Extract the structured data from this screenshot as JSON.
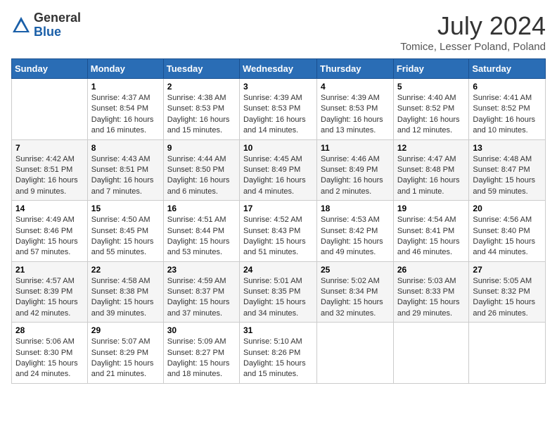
{
  "logo": {
    "general": "General",
    "blue": "Blue"
  },
  "header": {
    "title": "July 2024",
    "location": "Tomice, Lesser Poland, Poland"
  },
  "days_of_week": [
    "Sunday",
    "Monday",
    "Tuesday",
    "Wednesday",
    "Thursday",
    "Friday",
    "Saturday"
  ],
  "weeks": [
    [
      {
        "num": "",
        "info": ""
      },
      {
        "num": "1",
        "info": "Sunrise: 4:37 AM\nSunset: 8:54 PM\nDaylight: 16 hours\nand 16 minutes."
      },
      {
        "num": "2",
        "info": "Sunrise: 4:38 AM\nSunset: 8:53 PM\nDaylight: 16 hours\nand 15 minutes."
      },
      {
        "num": "3",
        "info": "Sunrise: 4:39 AM\nSunset: 8:53 PM\nDaylight: 16 hours\nand 14 minutes."
      },
      {
        "num": "4",
        "info": "Sunrise: 4:39 AM\nSunset: 8:53 PM\nDaylight: 16 hours\nand 13 minutes."
      },
      {
        "num": "5",
        "info": "Sunrise: 4:40 AM\nSunset: 8:52 PM\nDaylight: 16 hours\nand 12 minutes."
      },
      {
        "num": "6",
        "info": "Sunrise: 4:41 AM\nSunset: 8:52 PM\nDaylight: 16 hours\nand 10 minutes."
      }
    ],
    [
      {
        "num": "7",
        "info": "Sunrise: 4:42 AM\nSunset: 8:51 PM\nDaylight: 16 hours\nand 9 minutes."
      },
      {
        "num": "8",
        "info": "Sunrise: 4:43 AM\nSunset: 8:51 PM\nDaylight: 16 hours\nand 7 minutes."
      },
      {
        "num": "9",
        "info": "Sunrise: 4:44 AM\nSunset: 8:50 PM\nDaylight: 16 hours\nand 6 minutes."
      },
      {
        "num": "10",
        "info": "Sunrise: 4:45 AM\nSunset: 8:49 PM\nDaylight: 16 hours\nand 4 minutes."
      },
      {
        "num": "11",
        "info": "Sunrise: 4:46 AM\nSunset: 8:49 PM\nDaylight: 16 hours\nand 2 minutes."
      },
      {
        "num": "12",
        "info": "Sunrise: 4:47 AM\nSunset: 8:48 PM\nDaylight: 16 hours\nand 1 minute."
      },
      {
        "num": "13",
        "info": "Sunrise: 4:48 AM\nSunset: 8:47 PM\nDaylight: 15 hours\nand 59 minutes."
      }
    ],
    [
      {
        "num": "14",
        "info": "Sunrise: 4:49 AM\nSunset: 8:46 PM\nDaylight: 15 hours\nand 57 minutes."
      },
      {
        "num": "15",
        "info": "Sunrise: 4:50 AM\nSunset: 8:45 PM\nDaylight: 15 hours\nand 55 minutes."
      },
      {
        "num": "16",
        "info": "Sunrise: 4:51 AM\nSunset: 8:44 PM\nDaylight: 15 hours\nand 53 minutes."
      },
      {
        "num": "17",
        "info": "Sunrise: 4:52 AM\nSunset: 8:43 PM\nDaylight: 15 hours\nand 51 minutes."
      },
      {
        "num": "18",
        "info": "Sunrise: 4:53 AM\nSunset: 8:42 PM\nDaylight: 15 hours\nand 49 minutes."
      },
      {
        "num": "19",
        "info": "Sunrise: 4:54 AM\nSunset: 8:41 PM\nDaylight: 15 hours\nand 46 minutes."
      },
      {
        "num": "20",
        "info": "Sunrise: 4:56 AM\nSunset: 8:40 PM\nDaylight: 15 hours\nand 44 minutes."
      }
    ],
    [
      {
        "num": "21",
        "info": "Sunrise: 4:57 AM\nSunset: 8:39 PM\nDaylight: 15 hours\nand 42 minutes."
      },
      {
        "num": "22",
        "info": "Sunrise: 4:58 AM\nSunset: 8:38 PM\nDaylight: 15 hours\nand 39 minutes."
      },
      {
        "num": "23",
        "info": "Sunrise: 4:59 AM\nSunset: 8:37 PM\nDaylight: 15 hours\nand 37 minutes."
      },
      {
        "num": "24",
        "info": "Sunrise: 5:01 AM\nSunset: 8:35 PM\nDaylight: 15 hours\nand 34 minutes."
      },
      {
        "num": "25",
        "info": "Sunrise: 5:02 AM\nSunset: 8:34 PM\nDaylight: 15 hours\nand 32 minutes."
      },
      {
        "num": "26",
        "info": "Sunrise: 5:03 AM\nSunset: 8:33 PM\nDaylight: 15 hours\nand 29 minutes."
      },
      {
        "num": "27",
        "info": "Sunrise: 5:05 AM\nSunset: 8:32 PM\nDaylight: 15 hours\nand 26 minutes."
      }
    ],
    [
      {
        "num": "28",
        "info": "Sunrise: 5:06 AM\nSunset: 8:30 PM\nDaylight: 15 hours\nand 24 minutes."
      },
      {
        "num": "29",
        "info": "Sunrise: 5:07 AM\nSunset: 8:29 PM\nDaylight: 15 hours\nand 21 minutes."
      },
      {
        "num": "30",
        "info": "Sunrise: 5:09 AM\nSunset: 8:27 PM\nDaylight: 15 hours\nand 18 minutes."
      },
      {
        "num": "31",
        "info": "Sunrise: 5:10 AM\nSunset: 8:26 PM\nDaylight: 15 hours\nand 15 minutes."
      },
      {
        "num": "",
        "info": ""
      },
      {
        "num": "",
        "info": ""
      },
      {
        "num": "",
        "info": ""
      }
    ]
  ]
}
